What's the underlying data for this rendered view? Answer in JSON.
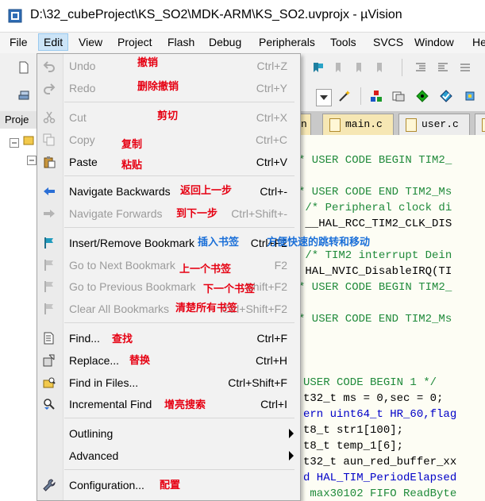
{
  "window": {
    "title": "D:\\32_cubeProject\\KS_SO2\\MDK-ARM\\KS_SO2.uvprojx - µVision"
  },
  "menubar": {
    "items": [
      "File",
      "Edit",
      "View",
      "Project",
      "Flash",
      "Debug",
      "Peripherals",
      "Tools",
      "SVCS",
      "Window",
      "He"
    ]
  },
  "project_tab": {
    "label": "Proje"
  },
  "tabs": [
    {
      "label": "n"
    },
    {
      "label": "main.c"
    },
    {
      "label": "user.c"
    }
  ],
  "edit_menu": {
    "undo": {
      "label": "Undo",
      "shortcut": "Ctrl+Z",
      "note": "撤销"
    },
    "redo": {
      "label": "Redo",
      "shortcut": "Ctrl+Y",
      "note": "删除撤销"
    },
    "cut": {
      "label": "Cut",
      "shortcut": "Ctrl+X",
      "note": "剪切"
    },
    "copy": {
      "label": "Copy",
      "shortcut": "Ctrl+C",
      "note": "复制"
    },
    "paste": {
      "label": "Paste",
      "shortcut": "Ctrl+V",
      "note": "粘贴"
    },
    "nav_back": {
      "label": "Navigate Backwards",
      "shortcut": "Ctrl+-",
      "note": "返回上一步"
    },
    "nav_fwd": {
      "label": "Navigate Forwards",
      "shortcut": "Ctrl+Shift+-",
      "note": "到下一步"
    },
    "bookmark": {
      "label": "Insert/Remove Bookmark",
      "shortcut": "Ctrl+F2",
      "note": "插入书签",
      "note2": "方便快速的跳转和移动"
    },
    "next_bm": {
      "label": "Go to Next Bookmark",
      "shortcut": "F2",
      "note": "上一个书签"
    },
    "prev_bm": {
      "label": "Go to Previous Bookmark",
      "shortcut": "Shift+F2",
      "note": "下一个书签"
    },
    "clear_bm": {
      "label": "Clear All Bookmarks",
      "shortcut": "Ctrl+Shift+F2",
      "note": "清楚所有书签"
    },
    "find": {
      "label": "Find...",
      "shortcut": "Ctrl+F",
      "note": "查找"
    },
    "replace": {
      "label": "Replace...",
      "shortcut": "Ctrl+H",
      "note": "替换"
    },
    "find_files": {
      "label": "Find in Files...",
      "shortcut": "Ctrl+Shift+F"
    },
    "inc_find": {
      "label": "Incremental Find",
      "shortcut": "Ctrl+I",
      "note": "增亮搜索"
    },
    "outlining": {
      "label": "Outlining"
    },
    "advanced": {
      "label": "Advanced"
    },
    "config": {
      "label": "Configuration...",
      "note": "配置"
    }
  },
  "code_lines": [
    "* USER CODE BEGIN TIM2_",
    "* USER CODE END TIM2_Ms",
    " /* Peripheral clock di",
    " __HAL_RCC_TIM2_CLK_DIS",
    " /* TIM2 interrupt Dein",
    " HAL_NVIC_DisableIRQ(TI",
    "* USER CODE BEGIN TIM2_",
    "* USER CODE END TIM2_Ms",
    "USER CODE BEGIN 1 */",
    "t32_t ms = 0,sec = 0;",
    "ern uint64_t HR_60,flag",
    "t8_t str1[100];",
    "t8_t temp_1[6];",
    "t32_t aun_red_buffer_xx",
    "d HAL_TIM_PeriodElapsed",
    " max30102 FIFO ReadByte"
  ]
}
